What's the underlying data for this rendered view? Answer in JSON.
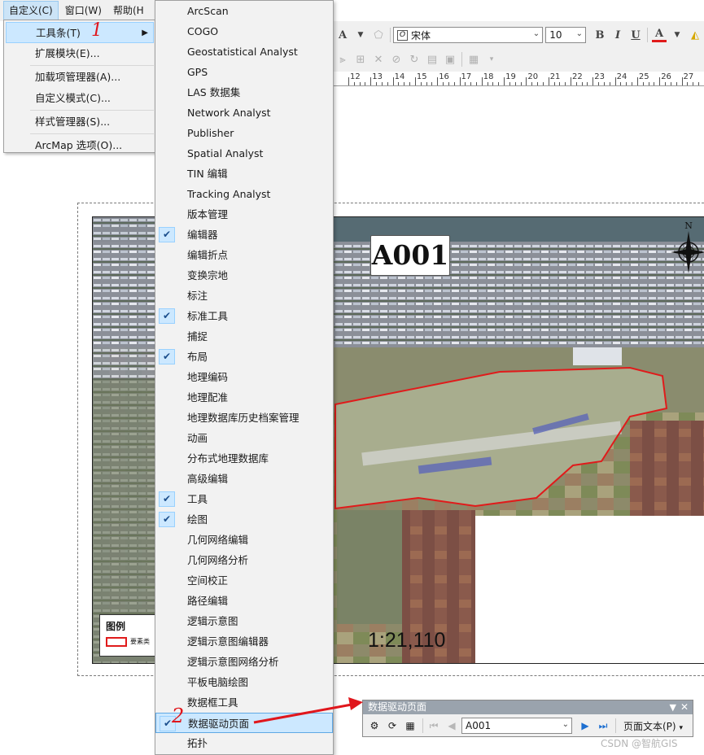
{
  "menubar": {
    "items": [
      "自定义(C)",
      "窗口(W)",
      "帮助(H"
    ]
  },
  "customize_menu": {
    "items": [
      "工具条(T)",
      "扩展模块(E)...",
      "加载项管理器(A)...",
      "自定义模式(C)...",
      "样式管理器(S)...",
      "ArcMap 选项(O)..."
    ],
    "step_label": "1"
  },
  "toolbar": {
    "font_name": "宋体",
    "font_size": "10",
    "bold": "B",
    "italic": "I",
    "underline": "U",
    "font_color": "A",
    "text_tool": "A"
  },
  "ruler": {
    "labels": [
      "12",
      "13",
      "14",
      "15",
      "16",
      "17",
      "18",
      "19",
      "20",
      "21",
      "22",
      "23",
      "24",
      "25",
      "26",
      "27"
    ]
  },
  "layout": {
    "map_title": "A001",
    "legend_title": "图例",
    "legend_label": "要素类",
    "scale_text": "1:21,110",
    "north_label": "N"
  },
  "toolbars_submenu": {
    "items": [
      {
        "label": "ArcScan",
        "checked": false
      },
      {
        "label": "COGO",
        "checked": false
      },
      {
        "label": "Geostatistical Analyst",
        "checked": false
      },
      {
        "label": "GPS",
        "checked": false
      },
      {
        "label": "LAS 数据集",
        "checked": false
      },
      {
        "label": "Network Analyst",
        "checked": false
      },
      {
        "label": "Publisher",
        "checked": false
      },
      {
        "label": "Spatial Analyst",
        "checked": false
      },
      {
        "label": "TIN 编辑",
        "checked": false
      },
      {
        "label": "Tracking Analyst",
        "checked": false
      },
      {
        "label": "版本管理",
        "checked": false
      },
      {
        "label": "编辑器",
        "checked": true
      },
      {
        "label": "编辑折点",
        "checked": false
      },
      {
        "label": "变换宗地",
        "checked": false
      },
      {
        "label": "标注",
        "checked": false
      },
      {
        "label": "标准工具",
        "checked": true
      },
      {
        "label": "捕捉",
        "checked": false
      },
      {
        "label": "布局",
        "checked": true
      },
      {
        "label": "地理编码",
        "checked": false
      },
      {
        "label": "地理配准",
        "checked": false
      },
      {
        "label": "地理数据库历史档案管理",
        "checked": false
      },
      {
        "label": "动画",
        "checked": false
      },
      {
        "label": "分布式地理数据库",
        "checked": false
      },
      {
        "label": "高级编辑",
        "checked": false
      },
      {
        "label": "工具",
        "checked": true
      },
      {
        "label": "绘图",
        "checked": true
      },
      {
        "label": "几何网络编辑",
        "checked": false
      },
      {
        "label": "几何网络分析",
        "checked": false
      },
      {
        "label": "空间校正",
        "checked": false
      },
      {
        "label": "路径编辑",
        "checked": false
      },
      {
        "label": "逻辑示意图",
        "checked": false
      },
      {
        "label": "逻辑示意图编辑器",
        "checked": false
      },
      {
        "label": "逻辑示意图网络分析",
        "checked": false
      },
      {
        "label": "平板电脑绘图",
        "checked": false
      },
      {
        "label": "数据框工具",
        "checked": false
      },
      {
        "label": "数据驱动页面",
        "checked": true,
        "highlighted": true
      },
      {
        "label": "拓扑",
        "checked": false
      }
    ],
    "step_label": "2"
  },
  "ddp_toolbar": {
    "title": "数据驱动页面",
    "current_page": "A001",
    "page_text_button": "页面文本(P)"
  },
  "watermark": "CSDN @智航GIS",
  "colors": {
    "accent_highlight": "#cce8ff",
    "annotation_red": "#e0161c",
    "boundary_red": "#e01b1b"
  }
}
